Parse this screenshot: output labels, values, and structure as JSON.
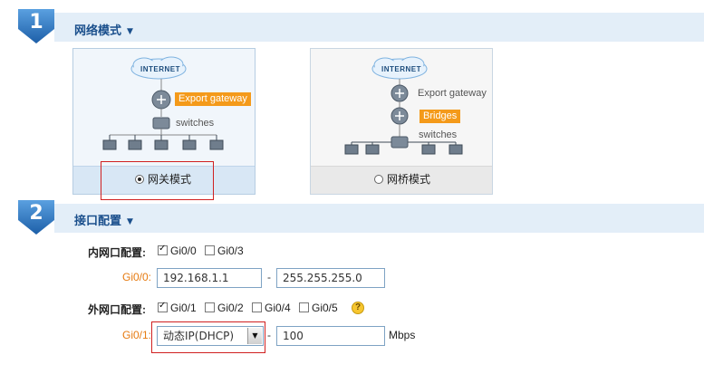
{
  "section1": {
    "number": "1",
    "title": "网络模式"
  },
  "section2": {
    "number": "2",
    "title": "接口配置"
  },
  "modes": {
    "gateway": {
      "label": "网关模式",
      "selected": true,
      "diagram": {
        "internet": "INTERNET",
        "export_gateway": "Export gateway",
        "switches": "switches"
      }
    },
    "bridge": {
      "label": "网桥模式",
      "selected": false,
      "diagram": {
        "internet": "INTERNET",
        "export_gateway": "Export gateway",
        "bridges": "Bridges",
        "switches": "switches"
      }
    }
  },
  "lan": {
    "label": "内网口配置:",
    "ports": [
      {
        "name": "Gi0/0",
        "checked": true
      },
      {
        "name": "Gi0/3",
        "checked": false
      }
    ],
    "config_label": "Gi0/0:",
    "ip": "192.168.1.1",
    "dash": "-",
    "mask": "255.255.255.0"
  },
  "wan": {
    "label": "外网口配置:",
    "ports": [
      {
        "name": "Gi0/1",
        "checked": true
      },
      {
        "name": "Gi0/2",
        "checked": false
      },
      {
        "name": "Gi0/4",
        "checked": false
      },
      {
        "name": "Gi0/5",
        "checked": false
      }
    ],
    "help": "?",
    "config_label": "Gi0/1:",
    "mode_selected": "动态IP(DHCP)",
    "dash": "-",
    "bandwidth": "100",
    "unit": "Mbps"
  },
  "colors": {
    "accent_blue": "#2a6fb8",
    "header_band": "#e3eef8",
    "orange_tag": "#f49a1a",
    "highlight_red": "#d02020"
  }
}
